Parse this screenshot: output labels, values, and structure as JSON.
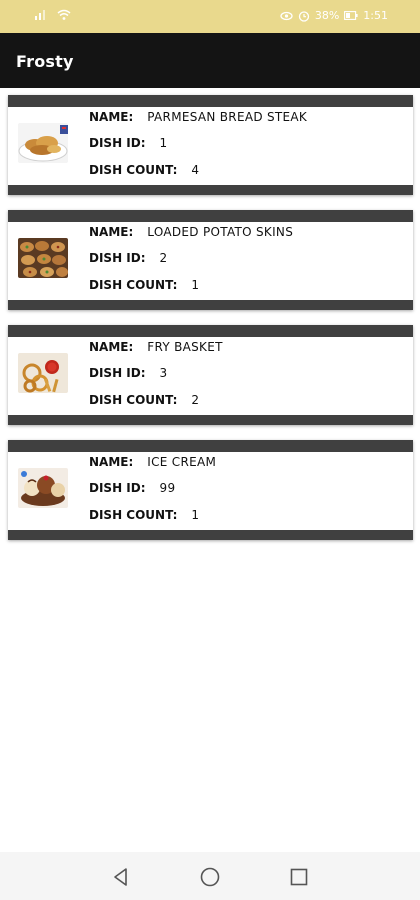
{
  "status_bar": {
    "battery_percent": "38%",
    "time": "1:51",
    "icons_left": [
      "signal-icon",
      "wifi-icon"
    ],
    "icons_right": [
      "eye-icon",
      "alarm-icon",
      "battery-icon"
    ]
  },
  "app_bar": {
    "title": "Frosty"
  },
  "labels": {
    "name": "NAME:",
    "dish_id": "DISH ID:",
    "dish_count": "DISH COUNT:"
  },
  "dishes": [
    {
      "name": "PARMESAN BREAD STEAK",
      "dish_id": "1",
      "dish_count": "4",
      "image": "bread-steak-image"
    },
    {
      "name": "LOADED POTATO SKINS",
      "dish_id": "2",
      "dish_count": "1",
      "image": "potato-skins-image"
    },
    {
      "name": "FRY BASKET",
      "dish_id": "3",
      "dish_count": "2",
      "image": "fry-basket-image"
    },
    {
      "name": "ICE CREAM",
      "dish_id": "99",
      "dish_count": "1",
      "image": "ice-cream-image"
    }
  ],
  "nav_bar": {
    "buttons": [
      "back-icon",
      "home-icon",
      "recents-icon"
    ]
  },
  "colors": {
    "status_bar": "#e9d98d",
    "app_bar": "#141414",
    "card_stripe": "#404040"
  }
}
